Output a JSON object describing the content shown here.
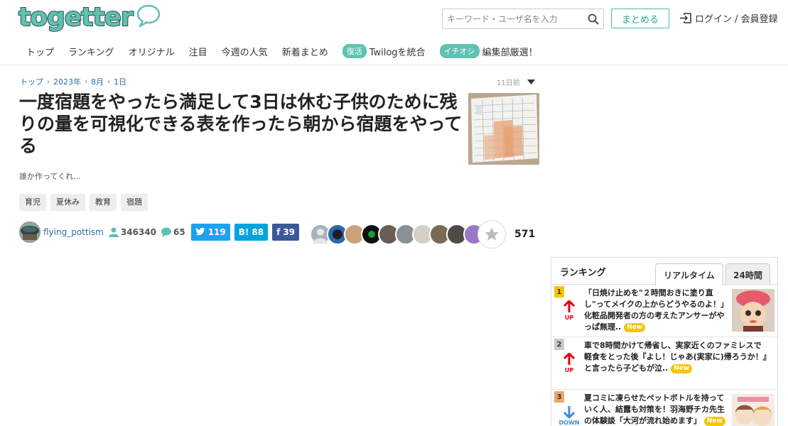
{
  "header": {
    "logo_text": "togetter",
    "search_placeholder": "キーワード・ユーザ名を入力",
    "matome_label": "まとめる",
    "login_label": "ログイン / 会員登録",
    "nav": [
      "トップ",
      "ランキング",
      "オリジナル",
      "注目",
      "今週の人気",
      "新着まとめ"
    ],
    "badge_items": [
      {
        "badge": "復活",
        "label": "Twilogを統合"
      },
      {
        "badge": "イチオシ",
        "label": "編集部厳選！"
      }
    ]
  },
  "breadcrumb": [
    "トップ",
    "2023年",
    "8月",
    "1日"
  ],
  "time_ago": "11日前",
  "article": {
    "title": "一度宿題をやったら満足して3日は休む子供のために残りの量を可視化できる表を作ったら朝から宿題をやってる",
    "description": "誰か作ってくれ...",
    "tags": [
      "育児",
      "夏休み",
      "教育",
      "宿題"
    ],
    "author": "flying_pottism",
    "views": "346340",
    "comments": "65",
    "twitter_count": "119",
    "hatena_label": "B!",
    "hatena_count": "88",
    "facebook_count": "39",
    "favorite_count": "571"
  },
  "ranking": {
    "title": "ランキング",
    "tab_realtime": "リアルタイム",
    "tab_24h": "24時間",
    "new_label": "New",
    "items": [
      {
        "rank": "1",
        "direction": "UP",
        "text": "「日焼け止めを\"２時間おきに塗り直し\"ってメイクの上からどうやるのよ！」化粧品開発者の方の考えたアンサーがやっぱ無理.."
      },
      {
        "rank": "2",
        "direction": "UP",
        "text": "車で8時間かけて帰省し、実家近くのファミレスで軽食をとった後『よし！じゃあ(実家に)帰ろうか！』と言ったら子どもが泣.."
      },
      {
        "rank": "3",
        "direction": "DOWN",
        "text": "夏コミに凍らせたペットボトルを持っていく人、結露も対策を！羽海野チカ先生の体験談「大河が流れ始めます」"
      }
    ]
  },
  "colors": {
    "brand": "#5ec2b2",
    "link": "#2e6ea3",
    "twitter": "#1da1f2",
    "hatena": "#00a4de",
    "facebook": "#3b5998",
    "up": "#e60012",
    "down": "#3a8fd6",
    "new_badge": "#f5c500"
  }
}
